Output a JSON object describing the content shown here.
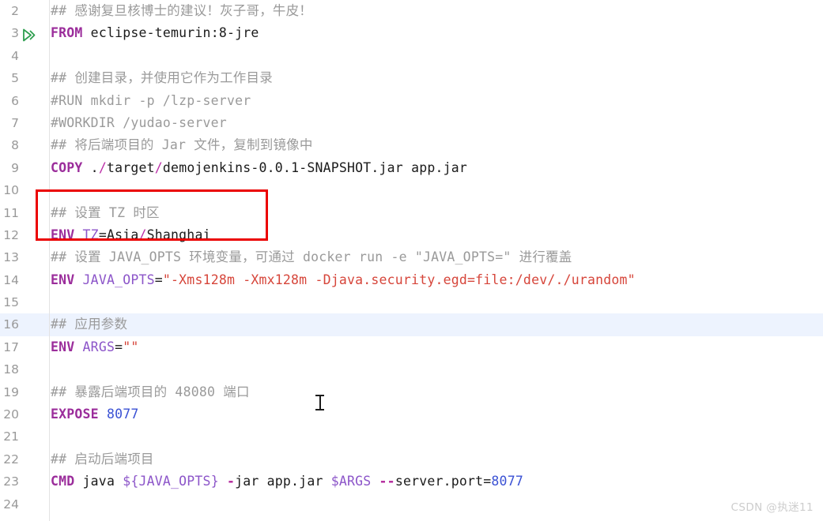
{
  "editor": {
    "language": "Dockerfile",
    "colors": {
      "keyword": "#9B2D9B",
      "comment": "#9A9A9A",
      "string": "#D6453A",
      "number": "#3B52D4",
      "variable": "#8C55C9",
      "separator": "#BC2FA8",
      "plain": "#1b1b1b",
      "current_line_highlight": "#EDF3FE",
      "annotation_box": "#EB0000",
      "line_number": "#999999",
      "gutter_rule": "#E3E3E3",
      "run_icon": "#2E9E4F",
      "watermark": "#CDCDCD"
    },
    "gutter_icon": "run-configuration-icon",
    "current_line": 16,
    "annotated_lines": [
      11,
      12
    ],
    "lines": [
      {
        "number": "2",
        "current": false,
        "run_icon": false,
        "tokens": [
          {
            "cls": "t-comment",
            "text": "## 感谢复旦核博士的建议！灰子哥，牛皮！"
          }
        ]
      },
      {
        "number": "3",
        "current": false,
        "run_icon": true,
        "tokens": [
          {
            "cls": "t-kw",
            "text": "FROM"
          },
          {
            "cls": "t-plain",
            "text": " eclipse-temurin:8-jre"
          }
        ]
      },
      {
        "number": "4",
        "current": false,
        "run_icon": false,
        "tokens": []
      },
      {
        "number": "5",
        "current": false,
        "run_icon": false,
        "tokens": [
          {
            "cls": "t-comment",
            "text": "## 创建目录，并使用它作为工作目录"
          }
        ]
      },
      {
        "number": "6",
        "current": false,
        "run_icon": false,
        "tokens": [
          {
            "cls": "t-comment",
            "text": "#RUN mkdir -p /lzp-server"
          }
        ]
      },
      {
        "number": "7",
        "current": false,
        "run_icon": false,
        "tokens": [
          {
            "cls": "t-comment",
            "text": "#WORKDIR /yudao-server"
          }
        ]
      },
      {
        "number": "8",
        "current": false,
        "run_icon": false,
        "tokens": [
          {
            "cls": "t-comment",
            "text": "## 将后端项目的 Jar 文件，复制到镜像中"
          }
        ]
      },
      {
        "number": "9",
        "current": false,
        "run_icon": false,
        "tokens": [
          {
            "cls": "t-kw",
            "text": "COPY"
          },
          {
            "cls": "t-plain",
            "text": " ."
          },
          {
            "cls": "t-sep",
            "text": "/"
          },
          {
            "cls": "t-plain",
            "text": "target"
          },
          {
            "cls": "t-sep",
            "text": "/"
          },
          {
            "cls": "t-plain",
            "text": "demojenkins-0.0.1-SNAPSHOT.jar app.jar"
          }
        ]
      },
      {
        "number": "10",
        "current": false,
        "run_icon": false,
        "tokens": []
      },
      {
        "number": "11",
        "current": false,
        "run_icon": false,
        "tokens": [
          {
            "cls": "t-comment",
            "text": "## 设置 TZ 时区"
          }
        ]
      },
      {
        "number": "12",
        "current": false,
        "run_icon": false,
        "tokens": [
          {
            "cls": "t-kw",
            "text": "ENV"
          },
          {
            "cls": "t-plain",
            "text": " "
          },
          {
            "cls": "t-var",
            "text": "TZ"
          },
          {
            "cls": "t-plain",
            "text": "=Asia"
          },
          {
            "cls": "t-sep",
            "text": "/"
          },
          {
            "cls": "t-plain",
            "text": "Shanghai"
          }
        ]
      },
      {
        "number": "13",
        "current": false,
        "run_icon": false,
        "tokens": [
          {
            "cls": "t-comment",
            "text": "## 设置 JAVA_OPTS 环境变量，可通过 docker run -e \"JAVA_OPTS=\" 进行覆盖"
          }
        ]
      },
      {
        "number": "14",
        "current": false,
        "run_icon": false,
        "tokens": [
          {
            "cls": "t-kw",
            "text": "ENV"
          },
          {
            "cls": "t-plain",
            "text": " "
          },
          {
            "cls": "t-var",
            "text": "JAVA_OPTS"
          },
          {
            "cls": "t-plain",
            "text": "="
          },
          {
            "cls": "t-str",
            "text": "\"-Xms128m -Xmx128m -Djava.security.egd=file:/dev/./urandom\""
          }
        ]
      },
      {
        "number": "15",
        "current": false,
        "run_icon": false,
        "tokens": []
      },
      {
        "number": "16",
        "current": true,
        "run_icon": false,
        "tokens": [
          {
            "cls": "t-comment",
            "text": "## 应用参数"
          }
        ]
      },
      {
        "number": "17",
        "current": false,
        "run_icon": false,
        "tokens": [
          {
            "cls": "t-kw",
            "text": "ENV"
          },
          {
            "cls": "t-plain",
            "text": " "
          },
          {
            "cls": "t-var",
            "text": "ARGS"
          },
          {
            "cls": "t-plain",
            "text": "="
          },
          {
            "cls": "t-str",
            "text": "\"\""
          }
        ]
      },
      {
        "number": "18",
        "current": false,
        "run_icon": false,
        "tokens": []
      },
      {
        "number": "19",
        "current": false,
        "run_icon": false,
        "tokens": [
          {
            "cls": "t-comment",
            "text": "## 暴露后端项目的 48080 端口"
          }
        ]
      },
      {
        "number": "20",
        "current": false,
        "run_icon": false,
        "tokens": [
          {
            "cls": "t-kw",
            "text": "EXPOSE"
          },
          {
            "cls": "t-plain",
            "text": " "
          },
          {
            "cls": "t-num",
            "text": "8077"
          }
        ]
      },
      {
        "number": "21",
        "current": false,
        "run_icon": false,
        "tokens": []
      },
      {
        "number": "22",
        "current": false,
        "run_icon": false,
        "tokens": [
          {
            "cls": "t-comment",
            "text": "## 启动后端项目"
          }
        ]
      },
      {
        "number": "23",
        "current": false,
        "run_icon": false,
        "tokens": [
          {
            "cls": "t-kw",
            "text": "CMD"
          },
          {
            "cls": "t-plain",
            "text": " java "
          },
          {
            "cls": "t-brace",
            "text": "${JAVA_OPTS}"
          },
          {
            "cls": "t-plain",
            "text": " "
          },
          {
            "cls": "t-flag",
            "text": "-"
          },
          {
            "cls": "t-plain",
            "text": "jar app.jar "
          },
          {
            "cls": "t-var",
            "text": "$ARGS"
          },
          {
            "cls": "t-plain",
            "text": " "
          },
          {
            "cls": "t-flag",
            "text": "--"
          },
          {
            "cls": "t-plain",
            "text": "server.port="
          },
          {
            "cls": "t-num",
            "text": "8077"
          }
        ]
      },
      {
        "number": "24",
        "current": false,
        "run_icon": false,
        "tokens": []
      }
    ]
  },
  "watermark": {
    "text": "CSDN @执迷11"
  }
}
